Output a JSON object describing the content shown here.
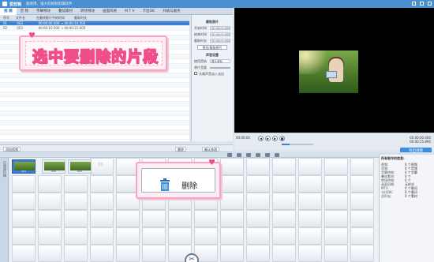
{
  "window": {
    "title": "爱剪辑",
    "subtitle": "超易用、强大的视频剪辑软件"
  },
  "menu": {
    "items": [
      "视 频",
      "音 频",
      "字幕特效",
      "叠加素材",
      "转场特效",
      "画面风格",
      "M T V",
      "卡拉OK",
      "升级与服务"
    ],
    "active": 0
  },
  "list": {
    "headers": [
      "序号",
      "文件名",
      "在最终影片中的时间",
      "截取时长"
    ],
    "rows": [
      {
        "index": "01",
        "name": "003",
        "time": "00:00:00.000 → 00:00:10.500",
        "selected": true
      },
      {
        "index": "02",
        "name": "003",
        "time": "00:00:10.500 → 00:00:21.000",
        "selected": false
      }
    ],
    "add_button": "添加视频",
    "delete_button": "删除",
    "confirm_button": "确认修改"
  },
  "settings": {
    "title": "截取原片",
    "start_label": "开始时间",
    "end_label": "结束时间",
    "dur_label": "截取时长",
    "time_value": "00:00:00.000",
    "preview_btn": "预览/截取原片",
    "audio_title": "声音设置",
    "track_label": "使用音轨",
    "track_value": "原片音轨",
    "volume_label": "原片音量",
    "checkbox_label": "头尾声音淡入淡出"
  },
  "callout_select": {
    "text": "选中要删除的片段"
  },
  "callout_delete": {
    "label": "删除"
  },
  "player": {
    "timecode_left": "00:00:00",
    "time_current": "00:00:00.000",
    "time_total": "00:00:15.890"
  },
  "export": {
    "label": "导出视频"
  },
  "timeline": {
    "side_label": "已添加片段",
    "clips": [
      "003",
      "003"
    ],
    "clip_ghost": "03"
  },
  "info": {
    "title": "所有制作的信息:",
    "rows": [
      {
        "k": "视频:",
        "v": "0 个视频"
      },
      {
        "k": "音频:",
        "v": "0 个音频"
      },
      {
        "k": "字幕特效:",
        "v": "0 个字幕"
      },
      {
        "k": "叠加素材:",
        "v": "0 个"
      },
      {
        "k": "转场特效:",
        "v": "0 个"
      },
      {
        "k": "画面风格:",
        "v": "无样式"
      },
      {
        "k": "MTV:",
        "v": "0 个歌词"
      },
      {
        "k": "卡拉OK:",
        "v": "0 个歌词"
      },
      {
        "k": "总时长:",
        "v": "0 个素材"
      }
    ]
  }
}
